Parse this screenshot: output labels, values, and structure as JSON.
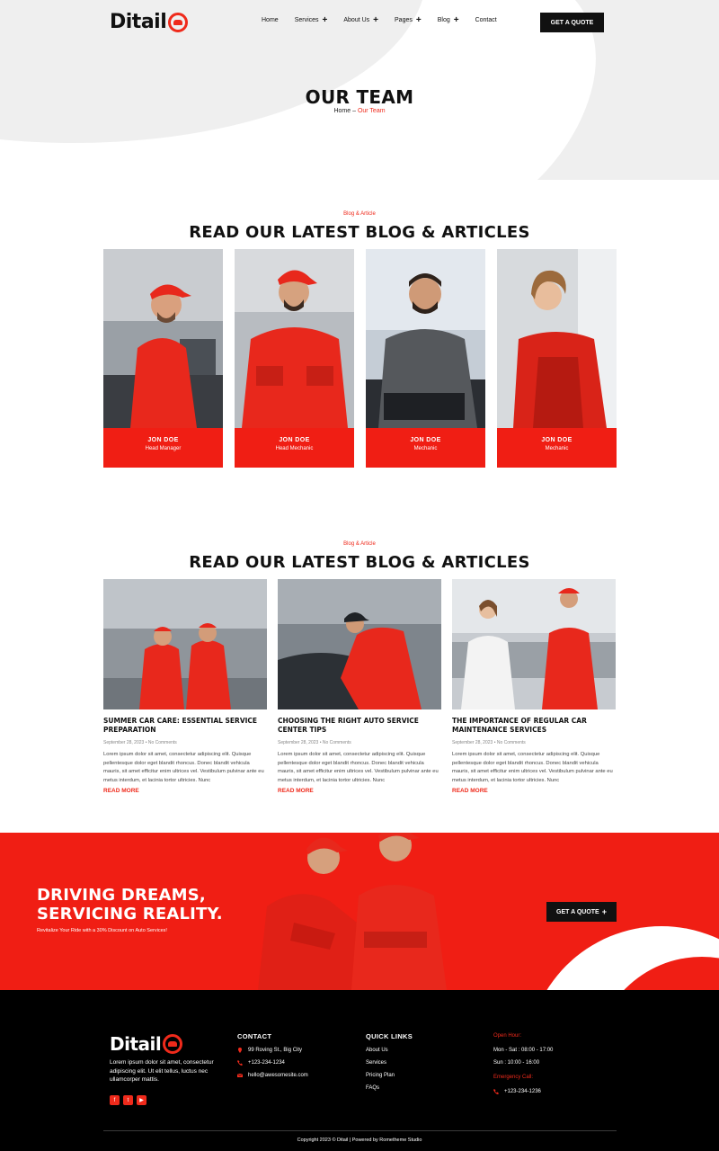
{
  "brand": {
    "name": "Ditail",
    "accent": "#ef2a1b",
    "dark": "#111111"
  },
  "nav": {
    "items": [
      {
        "label": "Home",
        "has_submenu": false
      },
      {
        "label": "Services",
        "has_submenu": true
      },
      {
        "label": "About Us",
        "has_submenu": true
      },
      {
        "label": "Pages",
        "has_submenu": true
      },
      {
        "label": "Blog",
        "has_submenu": true
      },
      {
        "label": "Contact",
        "has_submenu": false
      }
    ],
    "quote_button": "GET A QUOTE"
  },
  "hero": {
    "title": "OUR TEAM",
    "breadcrumb": {
      "home": "Home",
      "separator": " – ",
      "current": "Our Team"
    }
  },
  "team_section": {
    "eyebrow": "Blog & Article",
    "title": "READ OUR LATEST BLOG & ARTICLES",
    "members": [
      {
        "name": "JON DOE",
        "role": "Head Manager"
      },
      {
        "name": "JON DOE",
        "role": "Head Mechanic"
      },
      {
        "name": "JON DOE",
        "role": "Mechanic"
      },
      {
        "name": "JON DOE",
        "role": "Mechanic"
      }
    ]
  },
  "blog_section": {
    "eyebrow": "Blog & Article",
    "title": "READ OUR LATEST BLOG & ARTICLES",
    "posts": [
      {
        "title": "SUMMER CAR CARE: ESSENTIAL SERVICE PREPARATION",
        "meta": "September 28, 2023 • No Comments",
        "excerpt": "Lorem ipsum dolor sit amet, consectetur adipiscing elit. Quisque pellentesque dolor eget blandit rhoncus. Donec blandit vehicula mauris, sit amet efficitur enim ultrices vel. Vestibulum pulvinar ante eu metus interdum, et lacinia tortor ultricies. Nunc",
        "more": "READ MORE"
      },
      {
        "title": "CHOOSING THE RIGHT AUTO SERVICE CENTER TIPS",
        "meta": "September 28, 2023 • No Comments",
        "excerpt": "Lorem ipsum dolor sit amet, consectetur adipiscing elit. Quisque pellentesque dolor eget blandit rhoncus. Donec blandit vehicula mauris, sit amet efficitur enim ultrices vel. Vestibulum pulvinar ante eu metus interdum, et lacinia tortor ultricies. Nunc",
        "more": "READ MORE"
      },
      {
        "title": "THE IMPORTANCE OF REGULAR CAR MAINTENANCE SERVICES",
        "meta": "September 28, 2023 • No Comments",
        "excerpt": "Lorem ipsum dolor sit amet, consectetur adipiscing elit. Quisque pellentesque dolor eget blandit rhoncus. Donec blandit vehicula mauris, sit amet efficitur enim ultrices vel. Vestibulum pulvinar ante eu metus interdum, et lacinia tortor ultricies. Nunc",
        "more": "READ MORE"
      }
    ]
  },
  "cta": {
    "title_line1": "DRIVING DREAMS,",
    "title_line2": "SERVICING REALITY.",
    "subtitle": "Revitalize Your Ride with a 30% Discount on Auto Services!",
    "button": "GET A QUOTE"
  },
  "footer": {
    "about": "Lorem ipsum dolor sit amet, consectetur adipiscing elit. Ut elit tellus, luctus nec ullamcorper mattis.",
    "social_icons": [
      "facebook-icon",
      "twitter-icon",
      "youtube-icon"
    ],
    "contact": {
      "heading": "CONTACT",
      "address": "99 Roving St., Big City",
      "phone": "+123-234-1234",
      "email": "hello@awesomesite.com"
    },
    "links": {
      "heading": "QUICK LINKS",
      "items": [
        "About Us",
        "Services",
        "Pricing Plan",
        "FAQs"
      ]
    },
    "hours": {
      "open_label": "Open Hour:",
      "weekdays": "Mon - Sat : 08:00 - 17:00",
      "sunday": "Sun : 10:00 - 16:00",
      "emergency_label": "Emergency Call:",
      "emergency_phone": "+123-234-1236"
    },
    "copyright": "Copyright 2023 © Ditail | Powered by Rometheme Studio"
  }
}
